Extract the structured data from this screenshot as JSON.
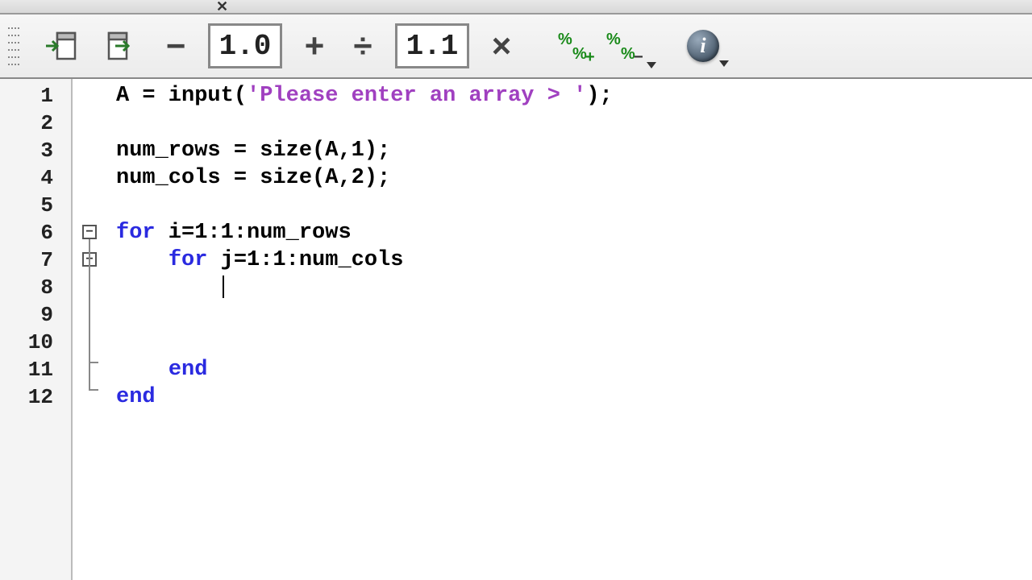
{
  "toolbar": {
    "close_glyph": "✕",
    "minus": "−",
    "plus": "+",
    "divide": "÷",
    "times": "×",
    "field1": "1.0",
    "field2": "1.1",
    "info": "i"
  },
  "gutter": [
    "1",
    "2",
    "3",
    "4",
    "5",
    "6",
    "7",
    "8",
    "9",
    "10",
    "11",
    "12"
  ],
  "code": {
    "l1_a": "A = input(",
    "l1_str": "'Please enter an array > '",
    "l1_b": ");",
    "l3": "num_rows = size(A,1);",
    "l4": "num_cols = size(A,2);",
    "l6_kw": "for",
    "l6_rest": " i=1:1:num_rows",
    "l7_indent": "    ",
    "l7_kw": "for",
    "l7_rest": " j=1:1:num_cols",
    "l8_indent": "        ",
    "l11_indent": "    ",
    "l11_kw": "end",
    "l12_kw": "end"
  },
  "fold": {
    "minus": "−"
  }
}
